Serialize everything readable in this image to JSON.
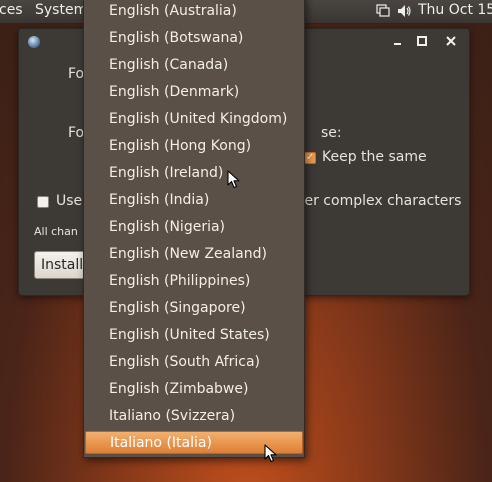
{
  "top_panel": {
    "menu_places": "ces",
    "menu_system": "System",
    "clock": "Thu Oct 15,"
  },
  "window": {
    "label_fo_1": "Fo",
    "label_fo_2": "Fo",
    "label_se": "se:",
    "keep_same_label": "Keep the same",
    "use_label": "Use",
    "complex_chars_text": "ter complex characters",
    "all_changes_text": "All chan",
    "install_button": "Install",
    "keep_same_checked": true,
    "use_checked": false
  },
  "dropdown": {
    "items": [
      "English (Australia)",
      "English (Botswana)",
      "English (Canada)",
      "English (Denmark)",
      "English (United Kingdom)",
      "English (Hong Kong)",
      "English (Ireland)",
      "English (India)",
      "English (Nigeria)",
      "English (New Zealand)",
      "English (Philippines)",
      "English (Singapore)",
      "English (United States)",
      "English (South Africa)",
      "English (Zimbabwe)",
      "Italiano (Svizzera)",
      "Italiano (Italia)"
    ],
    "selected_index": 16
  },
  "colors": {
    "selection_accent": "#de7f34",
    "menu_background": "#5b5048",
    "checkbox_checked": "#f09a4a"
  }
}
